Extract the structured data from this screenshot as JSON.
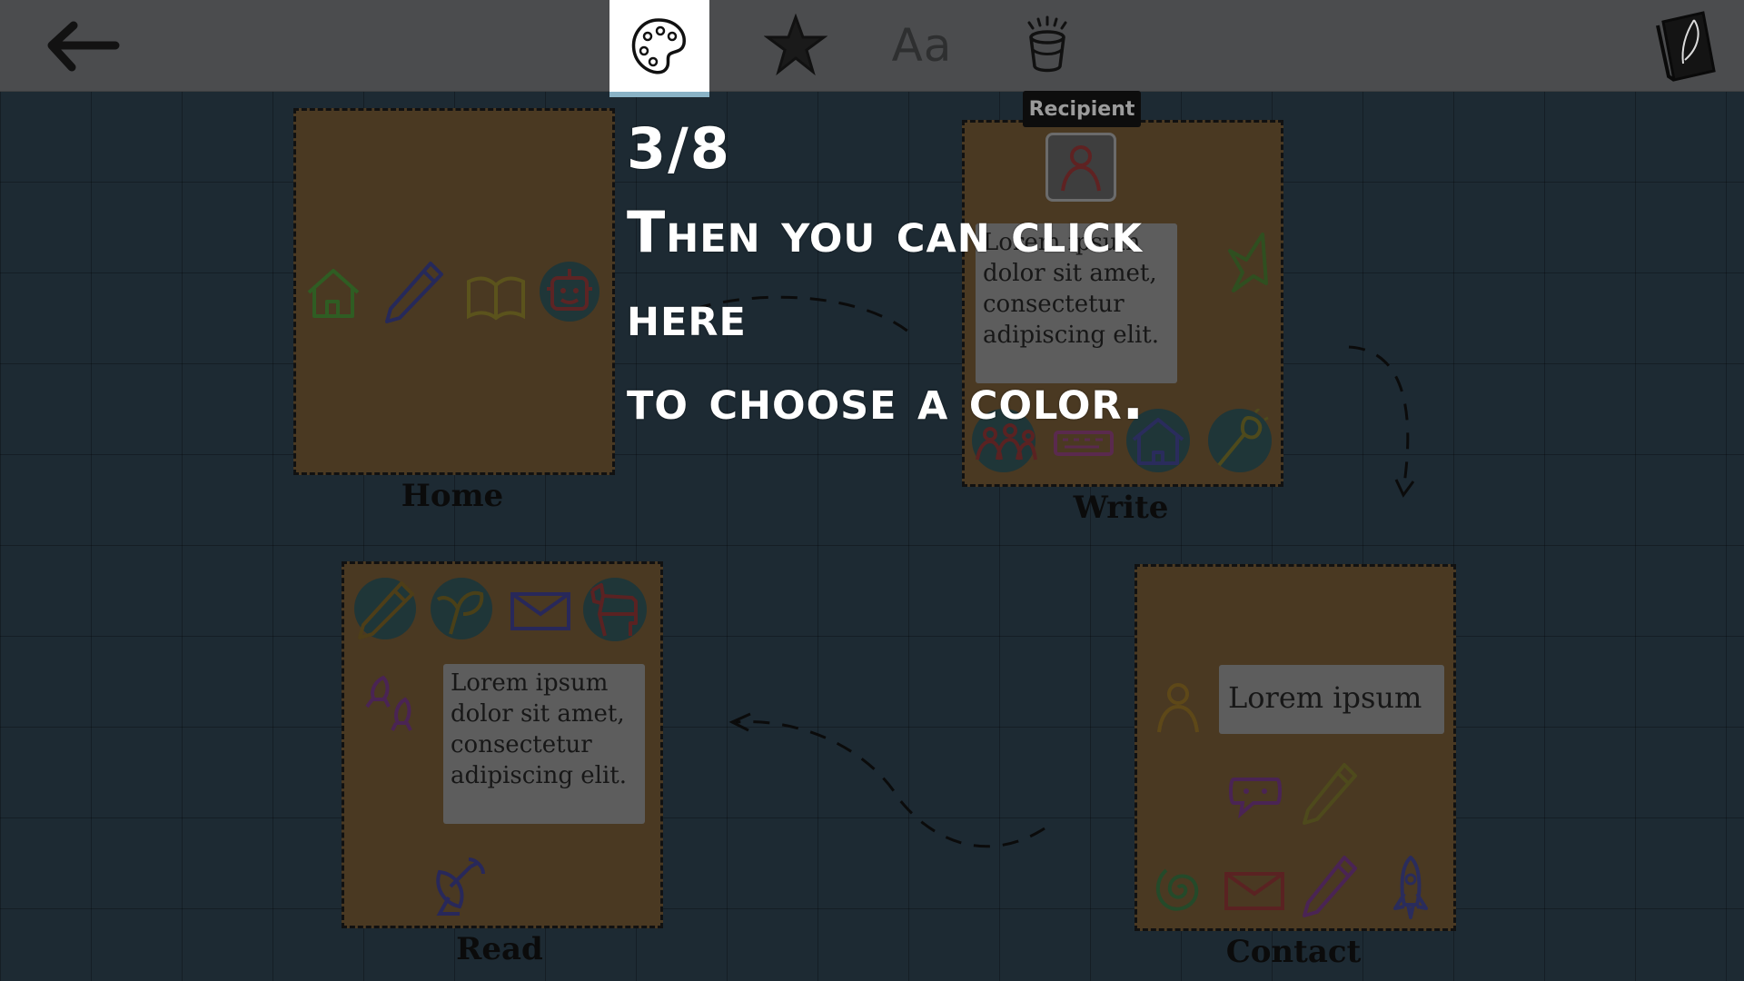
{
  "toolbar": {
    "back_icon": "back-arrow-icon",
    "palette_icon": "palette-icon",
    "star_icon": "star-icon",
    "font_label": "Aa",
    "bucket_icon": "paint-bucket-icon",
    "book_icon": "quill-book-icon"
  },
  "tutorial": {
    "step": "3/8",
    "message": "Then you can click here\nto choose a color."
  },
  "tooltip": {
    "label": "Recipient"
  },
  "pages": {
    "home": {
      "label": "Home"
    },
    "write": {
      "label": "Write",
      "text": "Lorem ipsum\ndolor sit amet,\nconsectetur\nadipiscing elit."
    },
    "read": {
      "label": "Read",
      "text": "Lorem ipsum\ndolor sit amet,\nconsectetur\nadipiscing elit."
    },
    "contact": {
      "label": "Contact",
      "text": "Lorem ipsum"
    }
  },
  "colors": {
    "background": "#1d2a33",
    "toolbar": "#4b4c4e",
    "card": "#4a3922",
    "selected_tab_underline": "#8ab3c6",
    "text_overlay": "#ffffff"
  }
}
